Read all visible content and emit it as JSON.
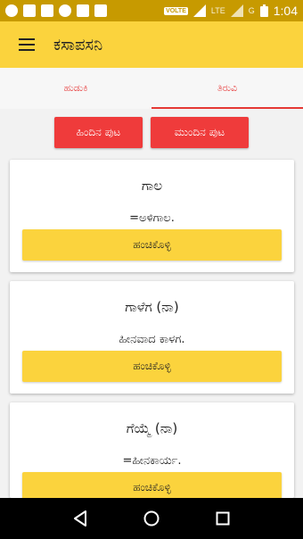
{
  "status_bar": {
    "network_badge": "VOLTE",
    "network_type": "LTE",
    "roaming": "G",
    "time": "1:04"
  },
  "app_bar": {
    "title": "ಕಸಾಪಸನಿ"
  },
  "tabs": [
    {
      "label": "ಹುಡುಕಿ",
      "active": false
    },
    {
      "label": "ತಿರುವಿ",
      "active": true
    }
  ],
  "pager": {
    "prev_label": "ಹಿಂದಿನ ಪುಟ",
    "next_label": "ಮುಂದಿನ ಪುಟ"
  },
  "entries": [
    {
      "word": "ಗಾಲ",
      "meaning": "=ಅಳಿಗಾಲ.",
      "share_label": "ಹಂಚಿಕೊಳ್ಳಿ"
    },
    {
      "word": "ಗಾಳೆಗ (ನಾ)",
      "meaning": "ಹೀನವಾದ ಕಾಳಗ.",
      "share_label": "ಹಂಚಿಕೊಳ್ಳಿ"
    },
    {
      "word": "ಗೆಯ್ಮೆ (ನಾ)",
      "meaning": "=ಹೀನಕಾರ್ಯ.",
      "share_label": "ಹಂಚಿಕೊಳ್ಳಿ"
    }
  ],
  "colors": {
    "accent": "#fbd33d",
    "primary_button": "#ef3b3b",
    "tab_text": "#e84a4a"
  }
}
